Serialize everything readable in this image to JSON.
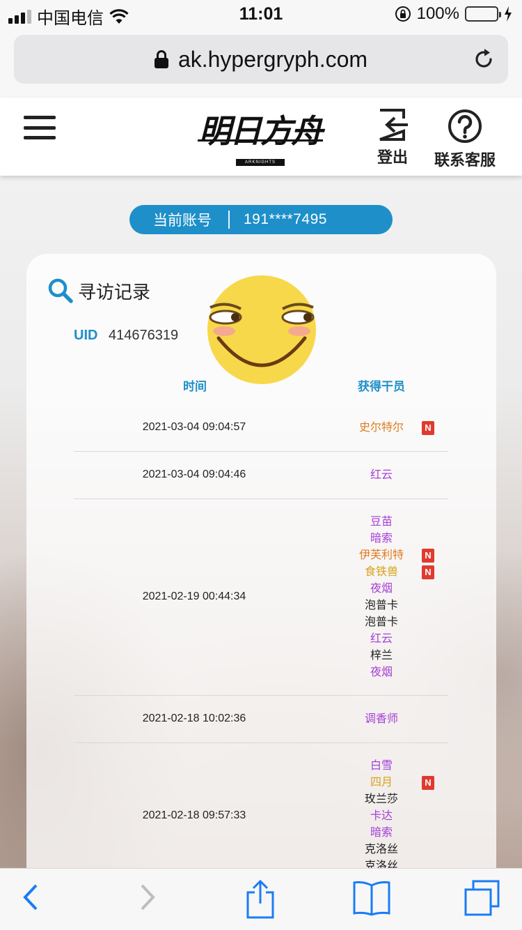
{
  "status_bar": {
    "carrier": "中国电信",
    "time": "11:01",
    "battery_percent": "100%",
    "battery_level": 1.0
  },
  "browser": {
    "url": "ak.hypergryph.com"
  },
  "site_header": {
    "logo_text": "明日方舟",
    "logo_sub": "ARKNIGHTS",
    "logout_label": "登出",
    "support_label": "联系客服"
  },
  "account": {
    "label": "当前账号",
    "value": "191****7495"
  },
  "card": {
    "title": "寻访记录",
    "uid_label": "UID",
    "uid_value": "414676319",
    "col_time": "时间",
    "col_operator": "获得干员"
  },
  "records": [
    {
      "time": "2021-03-04 09:04:57",
      "ops": [
        {
          "name": "史尔特尔",
          "color": "#e07a1f",
          "new": true
        }
      ]
    },
    {
      "time": "2021-03-04 09:04:46",
      "ops": [
        {
          "name": "红云",
          "color": "#a640d6",
          "new": false
        }
      ]
    },
    {
      "time": "2021-02-19 00:44:34",
      "ops": [
        {
          "name": "豆苗",
          "color": "#a640d6",
          "new": false
        },
        {
          "name": "暗索",
          "color": "#a640d6",
          "new": false
        },
        {
          "name": "伊芙利特",
          "color": "#e07a1f",
          "new": true
        },
        {
          "name": "食铁兽",
          "color": "#d9a21b",
          "new": true
        },
        {
          "name": "夜烟",
          "color": "#a640d6",
          "new": false
        },
        {
          "name": "泡普卡",
          "color": "#222222",
          "new": false
        },
        {
          "name": "泡普卡",
          "color": "#222222",
          "new": false
        },
        {
          "name": "红云",
          "color": "#a640d6",
          "new": false
        },
        {
          "name": "梓兰",
          "color": "#222222",
          "new": false
        },
        {
          "name": "夜烟",
          "color": "#a640d6",
          "new": false
        }
      ]
    },
    {
      "time": "2021-02-18 10:02:36",
      "ops": [
        {
          "name": "调香师",
          "color": "#a640d6",
          "new": false
        }
      ]
    },
    {
      "time": "2021-02-18 09:57:33",
      "ops": [
        {
          "name": "白雪",
          "color": "#a640d6",
          "new": false
        },
        {
          "name": "四月",
          "color": "#d9a21b",
          "new": true
        },
        {
          "name": "玫兰莎",
          "color": "#222222",
          "new": false
        },
        {
          "name": "卡达",
          "color": "#a640d6",
          "new": false
        },
        {
          "name": "暗索",
          "color": "#a640d6",
          "new": false
        },
        {
          "name": "克洛丝",
          "color": "#222222",
          "new": false
        },
        {
          "name": "克洛丝",
          "color": "#222222",
          "new": false
        }
      ]
    }
  ],
  "new_badge": "N",
  "accent_color": "#1e8fc9"
}
